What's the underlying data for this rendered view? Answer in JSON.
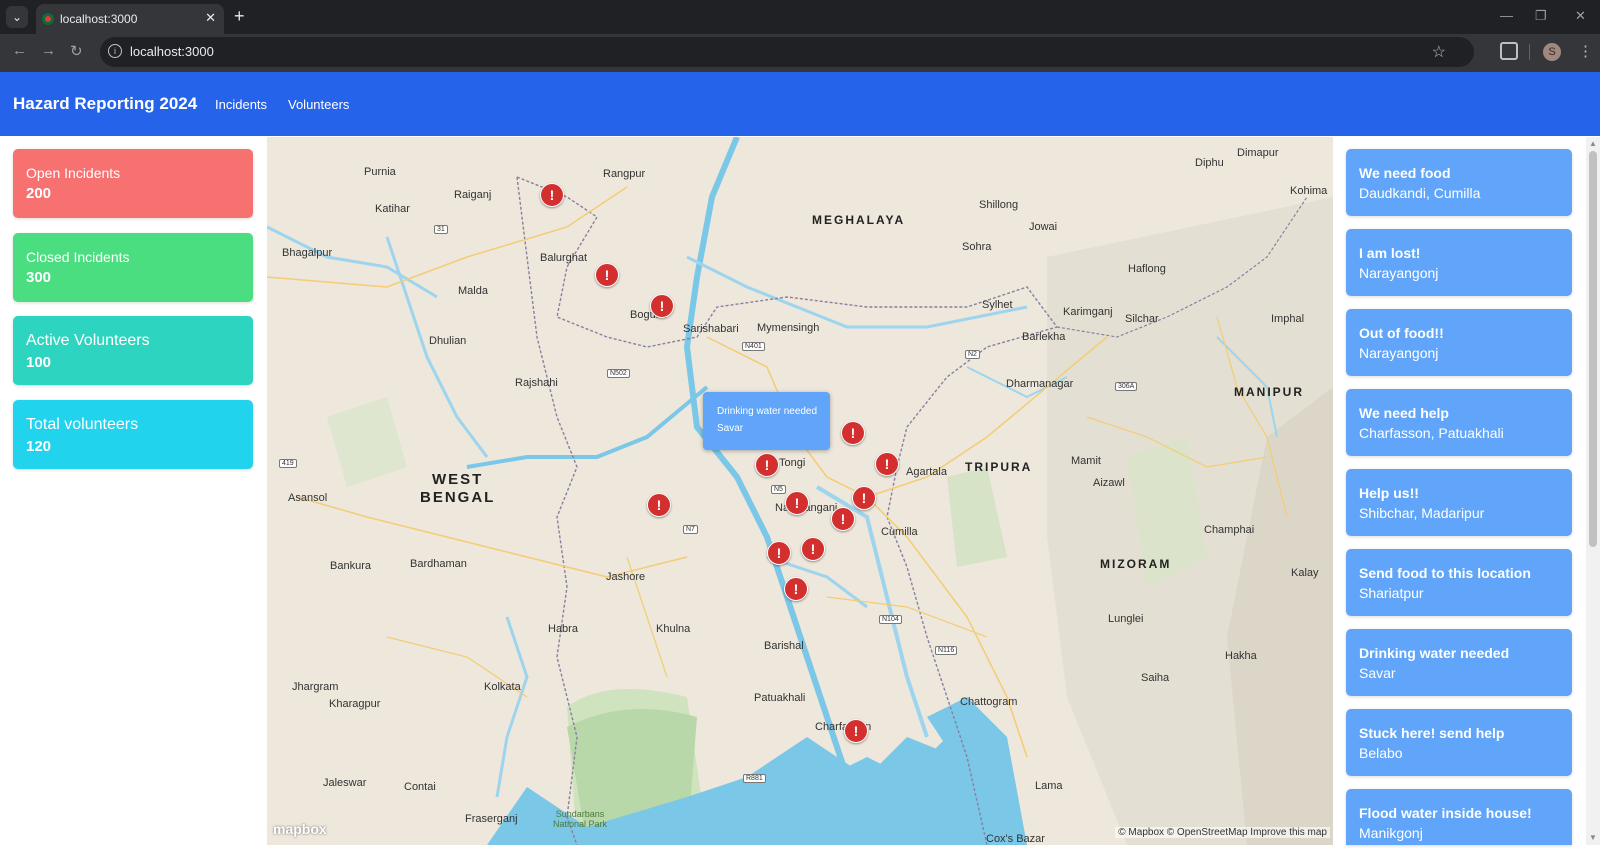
{
  "browser": {
    "tab_title": "localhost:3000",
    "url": "localhost:3000",
    "profile_initial": "S"
  },
  "header": {
    "brand": "Hazard Reporting 2024",
    "nav": [
      "Incidents",
      "Volunteers"
    ]
  },
  "stats": [
    {
      "label": "Open Incidents",
      "value": "200",
      "color": "#f87171"
    },
    {
      "label": "Closed Incidents",
      "value": "300",
      "color": "#4ade80"
    },
    {
      "label": "Active Volunteers",
      "value": "100",
      "color": "#2dd4bf"
    },
    {
      "label": "Total volunteers",
      "value": "120",
      "color": "#22d3ee"
    }
  ],
  "map": {
    "popup": {
      "title": "Drinking water needed",
      "location": "Savar"
    },
    "logo": "mapbox",
    "attribution": "© Mapbox © OpenStreetMap  Improve this map",
    "region_labels": [
      "MEGHALAYA",
      "WEST\nBENGAL",
      "TRIPURA",
      "MIZORAM",
      "MANIPUR"
    ],
    "place_labels": [
      "Purnia",
      "Raiganj",
      "Rangpur",
      "Dimapur",
      "Diphu",
      "Kohima",
      "Katihar",
      "Balurghat",
      "Shillong",
      "Jowai",
      "Bhagalpur",
      "Malda",
      "Sohra",
      "Haflong",
      "Bogura",
      "Sylhet",
      "Karimganj",
      "Silchar",
      "Imphal",
      "Dhulian",
      "Sarishabari",
      "Mymensingh",
      "Barlekha",
      "Rajshahi",
      "Dharmanagar",
      "Tongi",
      "Agartala",
      "Asansol",
      "Narayanganj",
      "Cumilla",
      "Mamit",
      "Aizawl",
      "Bankura",
      "Bardhaman",
      "Jashore",
      "Champhai",
      "Kalay",
      "Habra",
      "Khulna",
      "Barishal",
      "Lunglei",
      "Jhargram",
      "Kolkata",
      "Hakha",
      "Kharagpur",
      "Patuakhali",
      "Saiha",
      "Chattogram",
      "Charfasson",
      "Jaleswar",
      "Contai",
      "Fraserganj",
      "Sundarbans National Park",
      "Lama",
      "Cox's Bazar"
    ],
    "road_badges": [
      "31",
      "N401",
      "N2",
      "N502",
      "306A",
      "N5",
      "419",
      "N7",
      "N104",
      "N116",
      "R881"
    ]
  },
  "incidents": [
    {
      "title": "We need food",
      "location": "Daudkandi, Cumilla"
    },
    {
      "title": "I am lost!",
      "location": "Narayangonj"
    },
    {
      "title": "Out of food!!",
      "location": "Narayangonj"
    },
    {
      "title": "We need help",
      "location": "Charfasson, Patuakhali"
    },
    {
      "title": "Help us!!",
      "location": "Shibchar, Madaripur"
    },
    {
      "title": "Send food to this location",
      "location": "Shariatpur"
    },
    {
      "title": "Drinking water needed",
      "location": "Savar"
    },
    {
      "title": "Stuck here! send help",
      "location": "Belabo"
    },
    {
      "title": "Flood water inside house!",
      "location": "Manikgonj"
    }
  ]
}
